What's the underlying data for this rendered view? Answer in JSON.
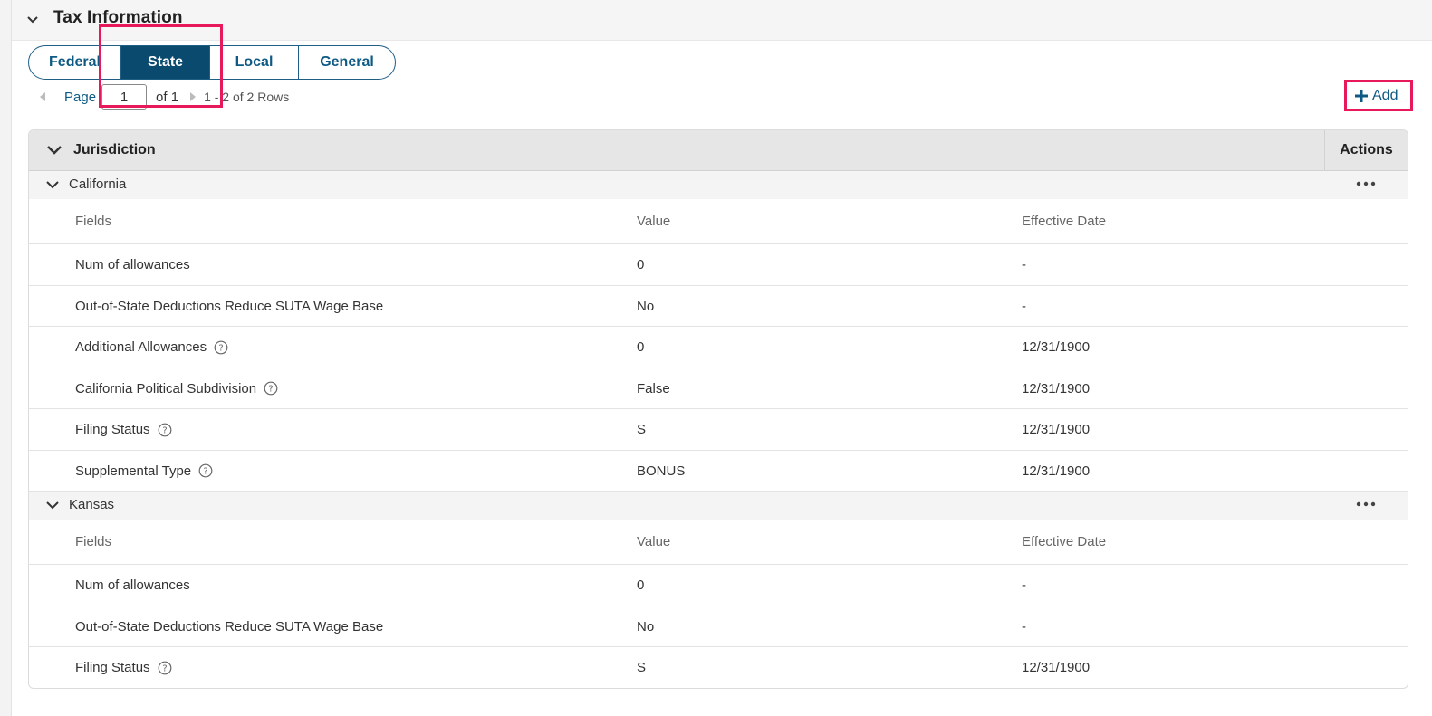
{
  "section": {
    "title": "Tax Information"
  },
  "tabs": [
    {
      "label": "Federal",
      "active": false
    },
    {
      "label": "State",
      "active": true
    },
    {
      "label": "Local",
      "active": false
    },
    {
      "label": "General",
      "active": false
    }
  ],
  "pager": {
    "page_label": "Page",
    "current_page": "1",
    "of_text": "of 1",
    "rows_text": "1 - 2 of 2 Rows"
  },
  "add_label": "Add",
  "grid": {
    "header_label": "Jurisdiction",
    "actions_label": "Actions",
    "column_headers": [
      "Fields",
      "Value",
      "Effective Date"
    ],
    "groups": [
      {
        "name": "California",
        "rows": [
          {
            "field": "Num of allowances",
            "value": "0",
            "date": "-",
            "help": false
          },
          {
            "field": "Out-of-State Deductions Reduce SUTA Wage Base",
            "value": "No",
            "date": "-",
            "help": false
          },
          {
            "field": "Additional Allowances",
            "value": "0",
            "date": "12/31/1900",
            "help": true
          },
          {
            "field": "California Political Subdivision",
            "value": "False",
            "date": "12/31/1900",
            "help": true
          },
          {
            "field": "Filing Status",
            "value": "S",
            "date": "12/31/1900",
            "help": true
          },
          {
            "field": "Supplemental Type",
            "value": "BONUS",
            "date": "12/31/1900",
            "help": true
          }
        ]
      },
      {
        "name": "Kansas",
        "rows": [
          {
            "field": "Num of allowances",
            "value": "0",
            "date": "-",
            "help": false
          },
          {
            "field": "Out-of-State Deductions Reduce SUTA Wage Base",
            "value": "No",
            "date": "-",
            "help": false
          },
          {
            "field": "Filing Status",
            "value": "S",
            "date": "12/31/1900",
            "help": true
          }
        ]
      }
    ]
  },
  "colors": {
    "accent": "#0e5a84",
    "active_tab_bg": "#0b4a6f",
    "highlight": "#e8195a"
  },
  "icons": {
    "section_toggle": "chevron-down-icon",
    "pager_prev": "triangle-left-icon",
    "pager_next": "triangle-right-icon",
    "add": "plus-icon",
    "row_actions": "more-horizontal-icon",
    "help": "help-circle-icon"
  }
}
